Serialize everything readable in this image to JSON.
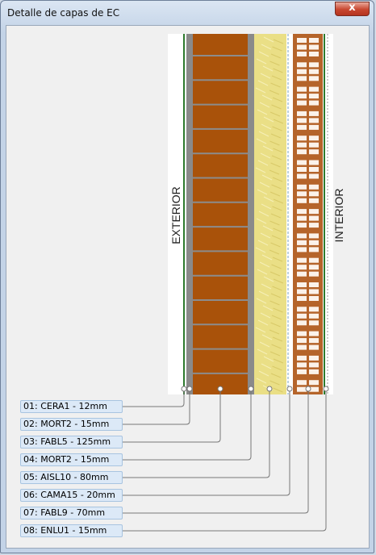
{
  "window": {
    "title": "Detalle de capas de EC",
    "close_symbol": "x"
  },
  "sides": {
    "exterior": "EXTERIOR",
    "interior": "INTERIOR"
  },
  "layers": [
    {
      "label": "01: CERA1 - 12mm"
    },
    {
      "label": "02: MORT2 - 15mm"
    },
    {
      "label": "03: FABL5 - 125mm"
    },
    {
      "label": "04: MORT2 - 15mm"
    },
    {
      "label": "05: AISL10 - 80mm"
    },
    {
      "label": "06: CAMA15 - 20mm"
    },
    {
      "label": "07: FABL9 - 70mm"
    },
    {
      "label": "08: ENLU1 - 15mm"
    }
  ],
  "colors": {
    "brick": "#a9520a",
    "brick_joint": "#8c8c8c",
    "mortar": "#888888",
    "insulation": "#eadf86",
    "hollow_brick": "#b5642a",
    "hollow_cell": "#fbf2ea",
    "finish_line": "#2d7a2d"
  }
}
